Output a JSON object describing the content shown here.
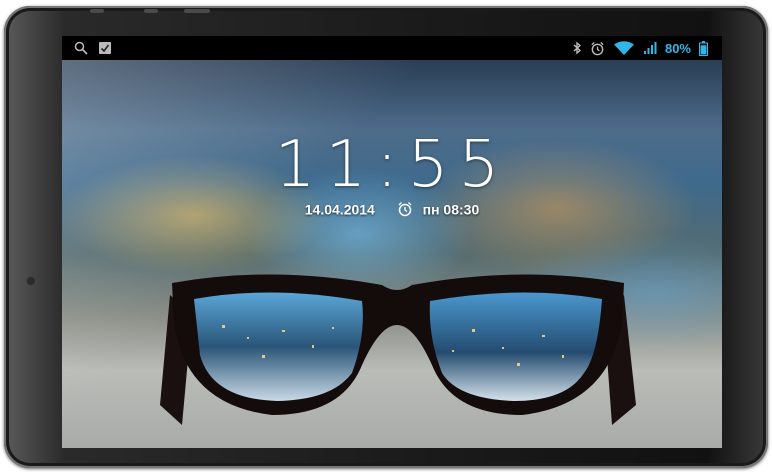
{
  "status_bar": {
    "left_icons": [
      "search-icon",
      "checkbox-icon"
    ],
    "right_icons": [
      "bluetooth-icon",
      "alarm-icon",
      "wifi-icon",
      "signal-icon"
    ],
    "battery_percent_label": "80%",
    "battery_level": 0.8
  },
  "lock_screen": {
    "time": "11:55",
    "date": "14.04.2014",
    "alarm": "пн 08:30"
  },
  "colors": {
    "accent": "#33b5e5",
    "frame": "#1c1c1c"
  }
}
